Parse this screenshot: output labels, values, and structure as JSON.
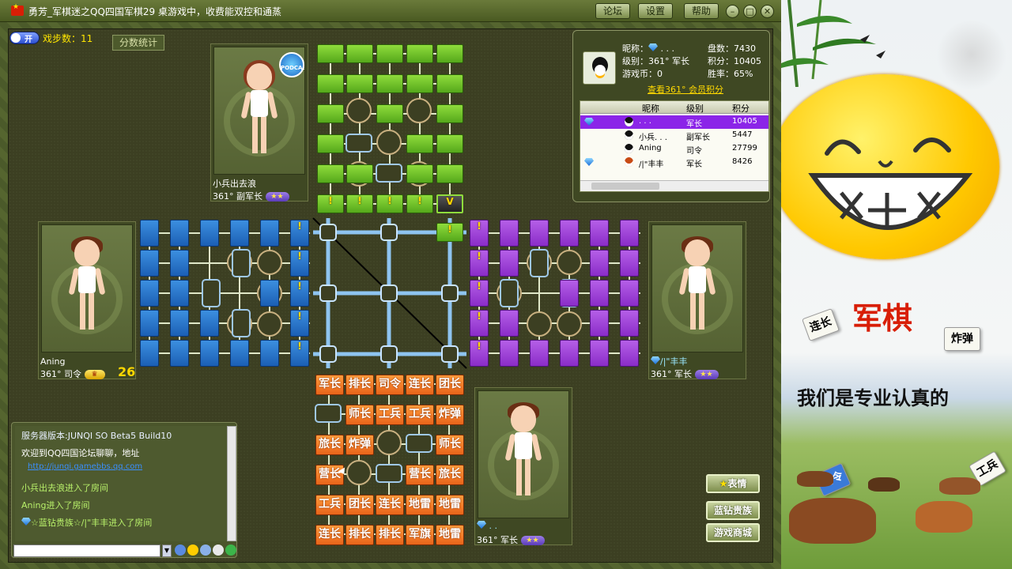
{
  "window": {
    "title": "勇芳_军棋迷之QQ四国军棋29  桌游戏中，收费能双控和通蒸",
    "buttons": {
      "forum": "论坛",
      "settings": "设置",
      "help": "帮助"
    }
  },
  "toolbar": {
    "toggle": "开",
    "step_count_label": "戏步数：11",
    "score_stats": "分数统计"
  },
  "players": {
    "top": {
      "name": "小兵出去浪",
      "rank": "361° 副军长"
    },
    "left": {
      "name": "Aning",
      "rank": "361° 司令",
      "timer": "26"
    },
    "right": {
      "name": "/|\"丰丰",
      "rank": "361° 军长"
    },
    "bottom": {
      "name": ". .",
      "rank": "361° 军长"
    }
  },
  "info": {
    "nickname_label": "昵称：",
    "nickname_value": ". . .",
    "games_label": "盘数：",
    "games_value": "7430",
    "level_label": "级别：",
    "level_value": "361° 军长",
    "points_label": "积分：",
    "points_value": "10405",
    "coins_label": "游戏币：",
    "coins_value": "0",
    "winrate_label": "胜率：",
    "winrate_value": "65%",
    "member_link": "查看361° 会员积分",
    "table_headers": [
      "昵称",
      "级别",
      "积分"
    ],
    "rows": [
      {
        "name": ". . .",
        "level": "军长",
        "score": "10405"
      },
      {
        "name": "小兵. . .",
        "level": "副军长",
        "score": "5447"
      },
      {
        "name": "Aning",
        "level": "司令",
        "score": "27799"
      },
      {
        "name": "/|\"丰丰",
        "level": "军长",
        "score": "8426"
      }
    ]
  },
  "board": {
    "marker": "!",
    "bottom_pieces": [
      [
        "军长",
        "排长",
        "司令",
        "连长",
        "团长"
      ],
      [
        "",
        "师长",
        "工兵",
        "工兵",
        "炸弹"
      ],
      [
        "旅长",
        "炸弹",
        "",
        "",
        "师长"
      ],
      [
        "营长",
        "",
        "",
        "营长",
        "旅长"
      ],
      [
        "工兵",
        "团长",
        "连长",
        "地雷",
        "地雷"
      ],
      [
        "连长",
        "排长",
        "排长",
        "军旗",
        "地雷"
      ]
    ]
  },
  "chat": {
    "lines": [
      "服务器版本:JUNQI SO Beta5 Build10",
      "欢迎到QQ四国论坛聊聊，地址",
      "http://junqi.gamebbs.qq.com",
      "小兵出去浪进入了房间",
      "Aning进入了房间",
      "☆蓝钻贵族☆/|\"丰丰进入了房间"
    ],
    "input_value": ""
  },
  "side_buttons": {
    "emote": "表情",
    "blue_diamond": "蓝钻贵族",
    "shop": "游戏商城"
  },
  "ad": {
    "title": "军棋",
    "slogan": "我们是专业认真的",
    "tile_lianzhang": "连长",
    "tile_zhadan": "炸弹",
    "tile_siling": "司令",
    "tile_gongbing": "工兵"
  }
}
